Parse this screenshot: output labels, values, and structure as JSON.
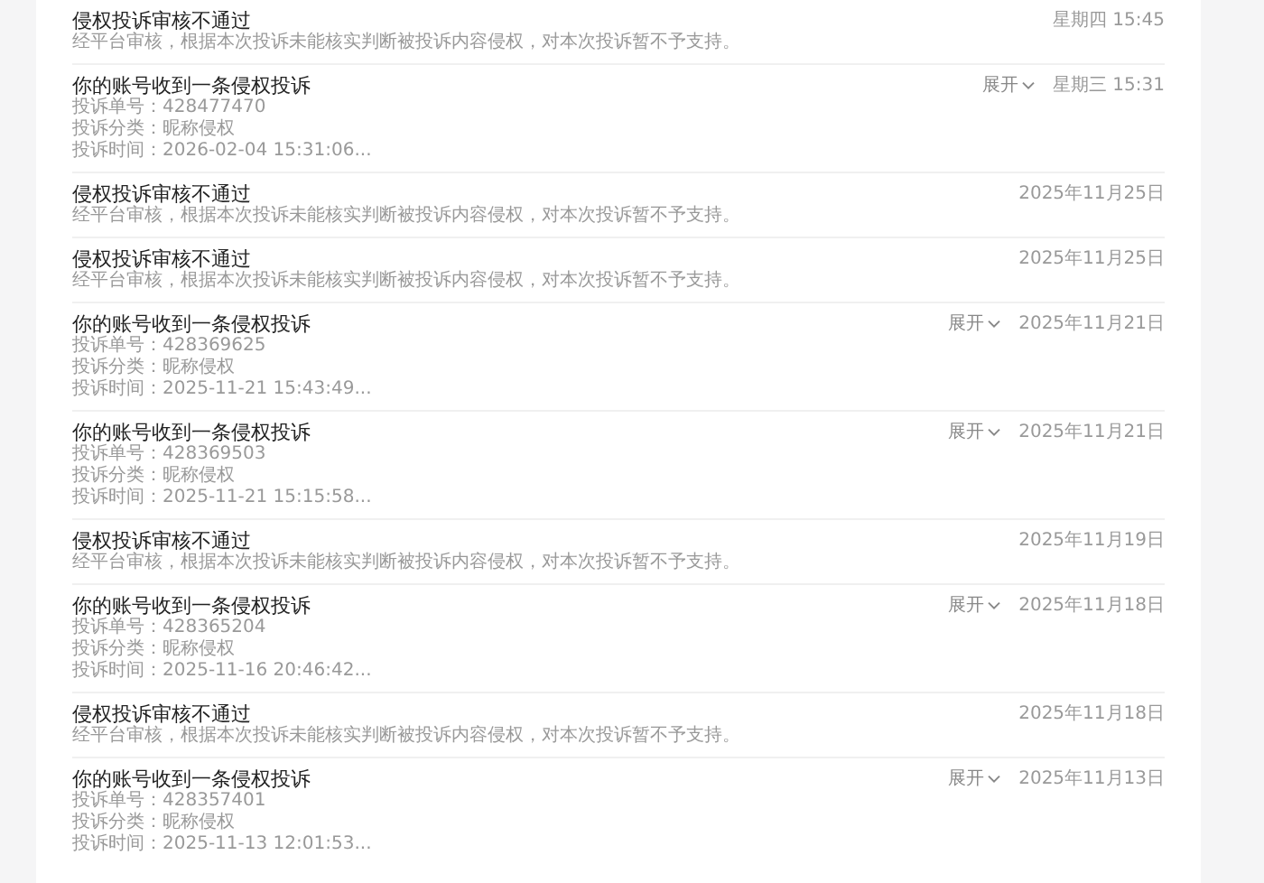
{
  "notifications": [
    {
      "kind": "notice",
      "title": "侵权投诉审核不通过",
      "text": "经平台审核，根据本次投诉未能核实判断被投诉内容侵权，对本次投诉暂不予支持。",
      "time": "星期四 15:45"
    },
    {
      "kind": "complaint",
      "title": "你的账号收到一条侵权投诉",
      "expand": "展开",
      "time": "星期三 15:31",
      "fields": [
        {
          "label": "投诉单号：",
          "value": "428477470"
        },
        {
          "label": "投诉分类：",
          "value": "昵称侵权"
        },
        {
          "label": "投诉时间：",
          "value": "2026-02-04 15:31:06..."
        }
      ]
    },
    {
      "kind": "notice",
      "title": "侵权投诉审核不通过",
      "text": "经平台审核，根据本次投诉未能核实判断被投诉内容侵权，对本次投诉暂不予支持。",
      "time": "2025年11月25日"
    },
    {
      "kind": "notice",
      "title": "侵权投诉审核不通过",
      "text": "经平台审核，根据本次投诉未能核实判断被投诉内容侵权，对本次投诉暂不予支持。",
      "time": "2025年11月25日"
    },
    {
      "kind": "complaint",
      "title": "你的账号收到一条侵权投诉",
      "expand": "展开",
      "time": "2025年11月21日",
      "fields": [
        {
          "label": "投诉单号：",
          "value": "428369625"
        },
        {
          "label": "投诉分类：",
          "value": "昵称侵权"
        },
        {
          "label": "投诉时间：",
          "value": "2025-11-21 15:43:49..."
        }
      ]
    },
    {
      "kind": "complaint",
      "title": "你的账号收到一条侵权投诉",
      "expand": "展开",
      "time": "2025年11月21日",
      "fields": [
        {
          "label": "投诉单号：",
          "value": "428369503"
        },
        {
          "label": "投诉分类：",
          "value": "昵称侵权"
        },
        {
          "label": "投诉时间：",
          "value": "2025-11-21 15:15:58..."
        }
      ]
    },
    {
      "kind": "notice",
      "title": "侵权投诉审核不通过",
      "text": "经平台审核，根据本次投诉未能核实判断被投诉内容侵权，对本次投诉暂不予支持。",
      "time": "2025年11月19日"
    },
    {
      "kind": "complaint",
      "title": "你的账号收到一条侵权投诉",
      "expand": "展开",
      "time": "2025年11月18日",
      "fields": [
        {
          "label": "投诉单号：",
          "value": "428365204"
        },
        {
          "label": "投诉分类：",
          "value": "昵称侵权"
        },
        {
          "label": "投诉时间：",
          "value": "2025-11-16 20:46:42..."
        }
      ]
    },
    {
      "kind": "notice",
      "title": "侵权投诉审核不通过",
      "text": "经平台审核，根据本次投诉未能核实判断被投诉内容侵权，对本次投诉暂不予支持。",
      "time": "2025年11月18日"
    },
    {
      "kind": "complaint",
      "title": "你的账号收到一条侵权投诉",
      "expand": "展开",
      "time": "2025年11月13日",
      "fields": [
        {
          "label": "投诉单号：",
          "value": "428357401"
        },
        {
          "label": "投诉分类：",
          "value": "昵称侵权"
        },
        {
          "label": "投诉时间：",
          "value": "2025-11-13 12:01:53..."
        }
      ]
    }
  ]
}
